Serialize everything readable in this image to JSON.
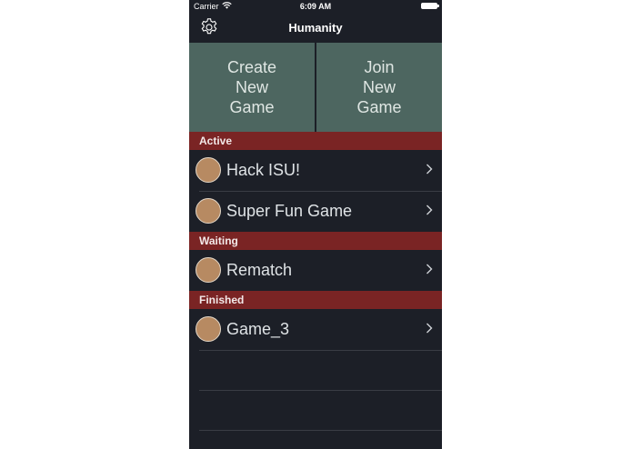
{
  "status_bar": {
    "carrier": "Carrier",
    "time": "6:09 AM"
  },
  "nav": {
    "title": "Humanity"
  },
  "tiles": {
    "create": "Create\nNew\nGame",
    "join": "Join\nNew\nGame"
  },
  "sections": {
    "active": {
      "title": "Active",
      "items": [
        {
          "name": "Hack ISU!"
        },
        {
          "name": "Super Fun Game"
        }
      ]
    },
    "waiting": {
      "title": "Waiting",
      "items": [
        {
          "name": "Rematch"
        }
      ]
    },
    "finished": {
      "title": "Finished",
      "items": [
        {
          "name": "Game_3"
        }
      ]
    }
  },
  "colors": {
    "background": "#1c1f27",
    "tile": "#4d6660",
    "section_header": "#7a2424",
    "avatar": "#b78a62"
  },
  "icons": {
    "settings": "gear-icon",
    "disclosure": "chevron-right-icon",
    "wifi": "wifi-icon",
    "battery": "battery-icon"
  }
}
